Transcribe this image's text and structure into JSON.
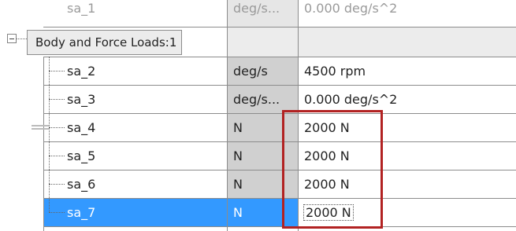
{
  "grid": {
    "top_row": {
      "name": "sa_1",
      "unit": "deg/s...",
      "value": "0.000 deg/s^2"
    },
    "group": {
      "label": "Body and Force Loads:1"
    },
    "rows": [
      {
        "name": "sa_2",
        "unit": "deg/s",
        "value": "4500 rpm"
      },
      {
        "name": "sa_3",
        "unit": "deg/s...",
        "value": "0.000 deg/s^2"
      },
      {
        "name": "sa_4",
        "unit": "N",
        "value": "2000 N"
      },
      {
        "name": "sa_5",
        "unit": "N",
        "value": "2000 N"
      },
      {
        "name": "sa_6",
        "unit": "N",
        "value": "2000 N"
      },
      {
        "name": "sa_7",
        "unit": "N",
        "value": "2000 N"
      }
    ],
    "selected_row": "sa_7"
  },
  "colors": {
    "selection": "#3399ff",
    "unit_column": "#d0d0d0",
    "highlight_border": "#b22222",
    "grid_line": "#8c8c8c"
  },
  "icons": [
    "collapse-minus-icon"
  ]
}
